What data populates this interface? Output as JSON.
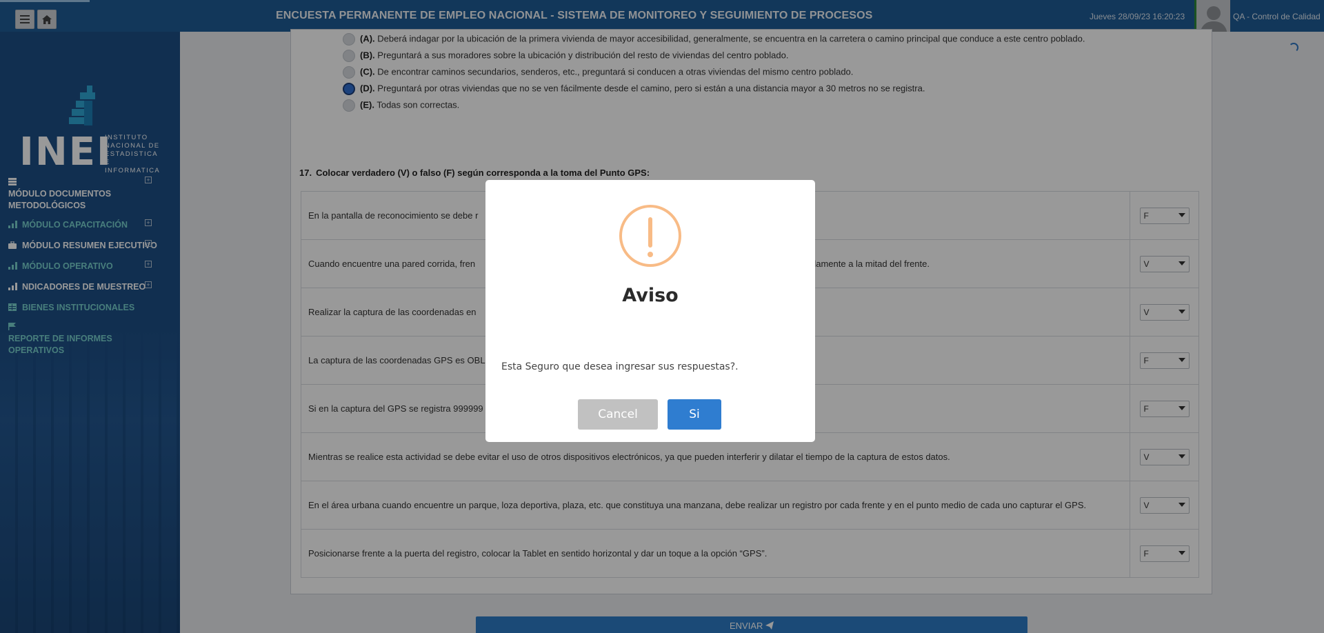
{
  "header": {
    "title": "ENCUESTA PERMANENTE DE EMPLEO NACIONAL - SISTEMA DE MONITOREO Y SEGUIMIENTO DE PROCESOS",
    "datetime": "Jueves 28/09/23 16:20:23",
    "user": "QA - Control de Calidad"
  },
  "logo": {
    "name": "INEI",
    "subtitle_lines": [
      "INSTITUTO",
      "NACIONAL DE",
      "ESTADISTICA E",
      "INFORMATICA"
    ]
  },
  "sidebar": {
    "items": [
      {
        "label": "MÓDULO DOCUMENTOS METODOLÓGICOS",
        "expandable": true
      },
      {
        "label": "MÓDULO CAPACITACIÓN",
        "expandable": true
      },
      {
        "label": "MÓDULO RESUMEN EJECUTIVO",
        "expandable": true
      },
      {
        "label": "MÓDULO OPERATIVO",
        "expandable": true
      },
      {
        "label": "NDICADORES DE MUESTREO",
        "expandable": true
      },
      {
        "label": "BIENES INSTITUCIONALES",
        "expandable": false
      },
      {
        "label": "REPORTE DE INFORMES OPERATIVOS",
        "expandable": false
      }
    ]
  },
  "question16": {
    "options": [
      {
        "letter": "(A).",
        "text": "Deberá indagar por la ubicación de la primera vivienda de mayor accesibilidad, generalmente, se encuentra en la carretera o camino principal que conduce a este centro poblado.",
        "selected": false
      },
      {
        "letter": "(B).",
        "text": "Preguntará a sus moradores sobre la ubicación y distribución del resto de viviendas del centro poblado.",
        "selected": false
      },
      {
        "letter": "(C).",
        "text": "De encontrar caminos secundarios, senderos, etc., preguntará si conducen a otras viviendas del mismo centro poblado.",
        "selected": false
      },
      {
        "letter": "(D).",
        "text": "Preguntará por otras viviendas que no se ven fácilmente desde el camino, pero si están a una distancia mayor a 30 metros no se registra.",
        "selected": true
      },
      {
        "letter": "(E).",
        "text": "Todas son correctas.",
        "selected": false
      }
    ]
  },
  "question17": {
    "number": "17.",
    "title": "Colocar verdadero (V) o falso (F) según corresponda a la toma del Punto GPS:",
    "rows": [
      {
        "text": "En la pantalla de reconocimiento se debe r",
        "value": "F"
      },
      {
        "text": "Cuando encuentre una pared corrida, fren",
        "text_end": "e tomarse aproximadamente a la mitad del frente.",
        "value": "V"
      },
      {
        "text": "Realizar la captura de las coordenadas en",
        "value": "V"
      },
      {
        "text": "La captura de las coordenadas GPS es OBL",
        "value": "F"
      },
      {
        "text": "Si en la captura del GPS se registra 999999",
        "value": "F"
      },
      {
        "text": "Mientras se realice esta actividad se debe evitar el uso de otros dispositivos electrónicos, ya que pueden interferir y dilatar el tiempo de la captura de estos datos.",
        "value": "V"
      },
      {
        "text": " En el área urbana cuando encuentre un parque, loza deportiva, plaza, etc. que constituya una manzana, debe realizar un registro por cada frente y en el punto medio de cada uno capturar el GPS.",
        "value": "V"
      },
      {
        "text": "Posicionarse frente a la puerta del registro, colocar la Tablet en sentido horizontal y dar un toque a la opción “GPS”.",
        "value": "F"
      }
    ]
  },
  "send_button": {
    "label": "ENVIAR"
  },
  "modal": {
    "title": "Aviso",
    "message": "Esta Seguro que desea ingresar sus respuestas?.",
    "cancel_label": "Cancel",
    "confirm_label": "Si",
    "icon": "warning-icon"
  },
  "colors": {
    "header_bg": "#1f5c96",
    "sidebar_bg": "#1d4f86",
    "accent_teal": "#79d2cf",
    "warning": "#f8bb86",
    "confirm": "#2f7dd0",
    "cancel": "#c1c1c1"
  }
}
